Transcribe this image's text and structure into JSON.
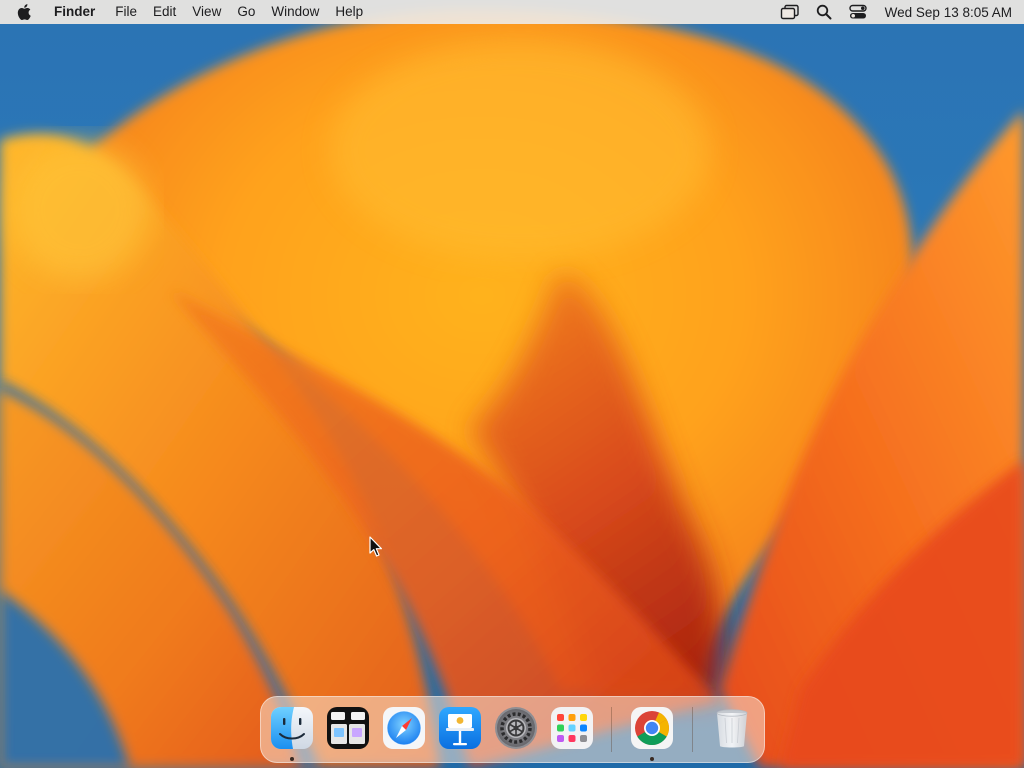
{
  "menubar": {
    "app_name": "Finder",
    "menus": [
      "File",
      "Edit",
      "View",
      "Go",
      "Window",
      "Help"
    ],
    "status_icons": [
      "screen-mirroring-icon",
      "spotlight-search-icon",
      "control-center-icon"
    ],
    "clock": "Wed Sep 13  8:05 AM"
  },
  "dock": {
    "apps": [
      {
        "name": "Finder",
        "icon": "finder-icon",
        "running": true
      },
      {
        "name": "Mission Control",
        "icon": "mission-control-icon",
        "running": false
      },
      {
        "name": "Safari",
        "icon": "safari-icon",
        "running": false
      },
      {
        "name": "Keynote",
        "icon": "keynote-icon",
        "running": false
      },
      {
        "name": "System Settings",
        "icon": "system-settings-icon",
        "running": false
      },
      {
        "name": "Launchpad",
        "icon": "launchpad-icon",
        "running": false
      },
      {
        "name": "Google Chrome",
        "icon": "chrome-icon",
        "running": true
      },
      {
        "name": "Trash",
        "icon": "trash-icon",
        "running": false
      }
    ]
  },
  "colors": {
    "wallpaper_blue": "#2a74b6",
    "wallpaper_orange": "#f7931e",
    "wallpaper_red": "#c8341b",
    "menubar_bg": "#eee8e2"
  }
}
